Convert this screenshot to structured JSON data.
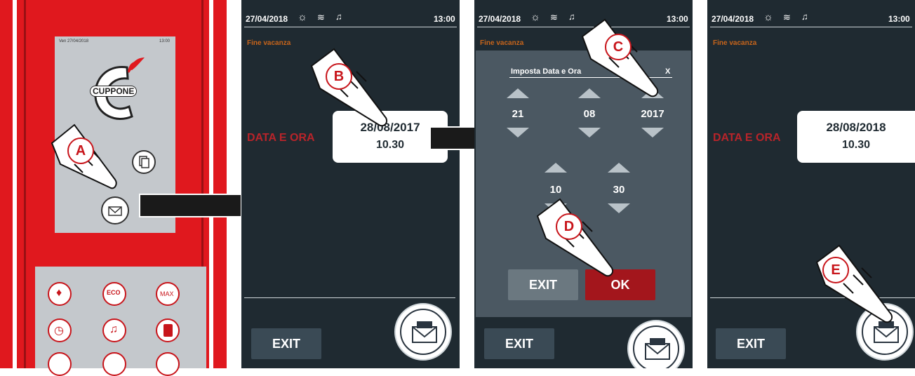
{
  "panel1": {
    "screen_date": "Ven 27/04/2018",
    "screen_time": "13:00",
    "logo_text": "CUPPONE",
    "eco_label": "ECO",
    "max_label": "MAX",
    "badge": "A"
  },
  "status": {
    "date": "27/04/2018",
    "time": "13:00"
  },
  "panel2": {
    "subtitle": "Fine vacanza",
    "data_label": "DATA E ORA",
    "date": "28/08/2017",
    "time": "10.30",
    "exit": "EXIT",
    "badge": "B"
  },
  "panel3": {
    "subtitle": "Fine vacanza",
    "dialog_title": "Imposta Data e Ora",
    "close": "X",
    "day": "21",
    "month": "08",
    "year": "2017",
    "hour": "10",
    "minute": "30",
    "exit": "EXIT",
    "ok": "OK",
    "badge_c": "C",
    "badge_d": "D",
    "exit_bottom": "EXIT"
  },
  "panel4": {
    "subtitle": "Fine vacanza",
    "data_label": "DATA E ORA",
    "date": "28/08/2018",
    "time": "10.30",
    "exit": "EXIT",
    "badge": "E"
  },
  "colors": {
    "red": "#e0181e",
    "dark": "#1f2a31",
    "accent_orange": "#c8651b"
  }
}
